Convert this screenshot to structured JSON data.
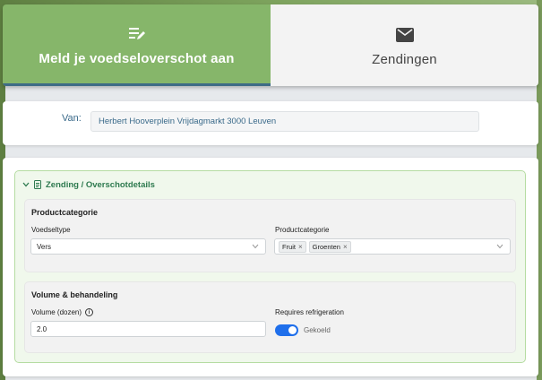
{
  "tabs": [
    {
      "label": "Meld je voedseloverschot aan",
      "icon": "edit-list-icon",
      "active": true
    },
    {
      "label": "Zendingen",
      "icon": "mail-icon",
      "active": false
    }
  ],
  "from": {
    "label": "Van:",
    "value": "Herbert Hooverplein Vrijdagmarkt 3000 Leuven"
  },
  "zending": {
    "title": "Zending / Overschotdetails",
    "sections": {
      "productcategory": {
        "title": "Productcategorie",
        "food_type_label": "Voedseltype",
        "food_type_value": "Vers",
        "category_label": "Productcategorie",
        "category_chips": [
          "Fruit",
          "Groenten"
        ],
        "chip_remove": "×"
      },
      "volume": {
        "title": "Volume & behandeling",
        "volume_label": "Volume (dozen)",
        "volume_info": "i",
        "volume_value": "2.0",
        "refrigeration_label": "Requires refrigeration",
        "refrigeration_state": "Gekoeld",
        "refrigeration_on": true
      }
    }
  },
  "colors": {
    "active_tab": "#86b66a",
    "accent_green": "#2e7a4f",
    "toggle_blue": "#1f6feb",
    "label_blue": "#3a6a8a"
  }
}
